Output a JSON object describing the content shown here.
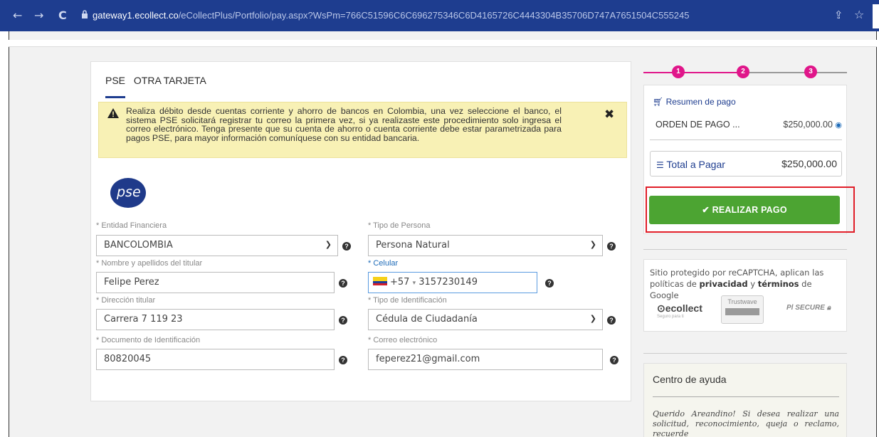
{
  "browser": {
    "url_host": "gateway1.ecollect.co",
    "url_path": "/eCollectPlus/Portfolio/pay.aspx?WsPm=766C51596C6C696275346C6D4165726C4443304B35706D747A7651504C555245"
  },
  "tabs": [
    "PSE",
    "OTRA TARJETA"
  ],
  "alert": {
    "message": "Realiza débito desde cuentas corriente y ahorro de bancos en Colombia, una vez seleccione el banco, el sistema PSE solicitará registrar tu correo la primera vez, si ya realizaste este procedimiento solo ingresa el correo electrónico. Tenga presente que su cuenta de ahorro o cuenta corriente debe estar parametrizada para pagos PSE, para mayor información comuníquese con su entidad bancaria."
  },
  "pse_logo": "pse",
  "form": {
    "entidad_label": "* Entidad Financiera",
    "entidad_value": "BANCOLOMBIA",
    "tipo_persona_label": "* Tipo de Persona",
    "tipo_persona_value": "Persona Natural",
    "nombre_label": "* Nombre y apellidos del titular",
    "nombre_value": "Felipe Perez",
    "celular_label": "* Celular",
    "celular_code": "+57",
    "celular_value": "3157230149",
    "direccion_label": "* Dirección titular",
    "direccion_value": "Carrera 7  119 23",
    "tipo_id_label": "* Tipo de Identificación",
    "tipo_id_value": "Cédula de Ciudadanía",
    "documento_label": "* Documento de Identificación",
    "documento_value": "80820045",
    "correo_label": "* Correo electrónico",
    "correo_value": "feperez21@gmail.com"
  },
  "steps": [
    "1",
    "2",
    "3"
  ],
  "summary": {
    "title": "Resumen de pago",
    "order_label": "ORDEN DE PAGO ...",
    "order_amount": "$250,000.00",
    "total_label": "Total a Pagar",
    "total_amount": "$250,000.00",
    "pay_button": "REALIZAR PAGO"
  },
  "captcha": {
    "text_before": "Sitio protegido por reCAPTCHA, aplican las políticas de ",
    "privacy": "privacidad",
    "and": " y ",
    "terms": "términos",
    "text_after": " de Google",
    "ecollect": "ecollect",
    "ecollect_tag": "Seguro para ti",
    "trustwave": "Trustwave",
    "secure": "SECURE"
  },
  "help": {
    "title": "Centro de ayuda",
    "text": "Querido Areandino! Si desea realizar una solicitud, reconocimiento, queja o reclamo, recuerde"
  },
  "colors": {
    "brand": "#1e3d8f",
    "step": "#e0168a",
    "pay": "#4ca432",
    "highlight": "#e01e28",
    "alert_bg": "#f8f1b5"
  }
}
